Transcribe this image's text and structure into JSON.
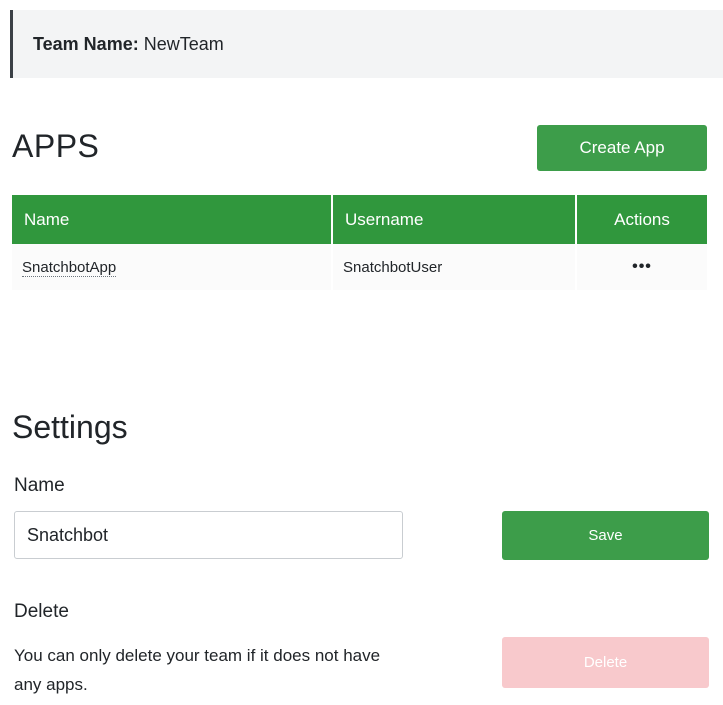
{
  "team_banner": {
    "label": "Team Name:",
    "value": "NewTeam"
  },
  "apps": {
    "title": "APPS",
    "create_button": "Create App",
    "columns": [
      "Name",
      "Username",
      "Actions"
    ],
    "rows": [
      {
        "name": "SnatchbotApp",
        "username": "SnatchbotUser",
        "actions": "•••"
      }
    ]
  },
  "settings": {
    "title": "Settings",
    "name_label": "Name",
    "name_value": "Snatchbot",
    "save_button": "Save",
    "delete_label": "Delete",
    "delete_description": "You can only delete your team if it does not have any apps.",
    "delete_button": "Delete"
  },
  "colors": {
    "primary_green": "#3d9d4a",
    "table_header_green": "#30973d",
    "delete_disabled": "#f8c9cc",
    "banner_bg": "#f3f4f5"
  }
}
